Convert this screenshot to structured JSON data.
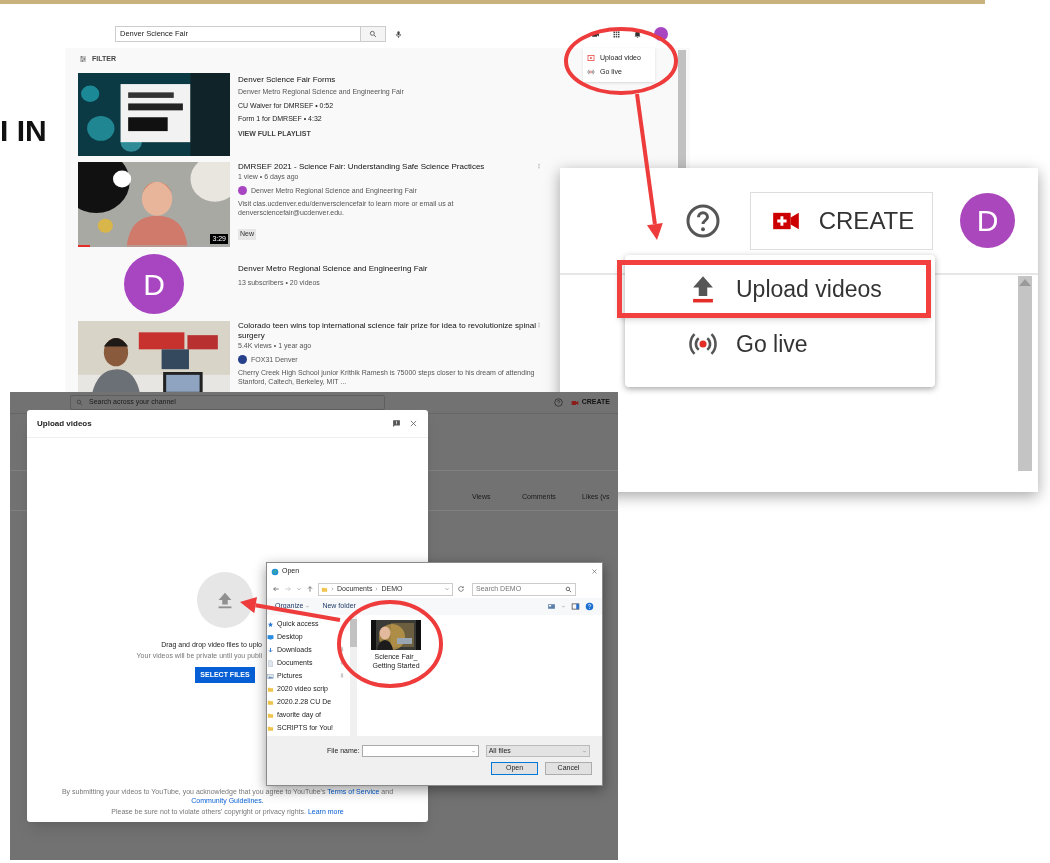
{
  "heading_fragment": "I IN",
  "results_page": {
    "search": {
      "value": "Denver Science Fair"
    },
    "create_menu": [
      {
        "label": "Upload video",
        "kind": "upload"
      },
      {
        "label": "Go live",
        "kind": "live"
      }
    ],
    "filter_label": "FILTER",
    "results": [
      {
        "kind": "playlist",
        "title": "Denver Science Fair Forms",
        "channel": "Denver Metro Regional Science and Engineering Fair",
        "items": [
          "CU Waiver for DMRSEF • 0:52",
          "Form 1 for DMRSEF • 4:32"
        ],
        "link": "VIEW FULL PLAYLIST"
      },
      {
        "kind": "video",
        "title": "DMRSEF 2021 - Science Fair: Understanding Safe Science Practices",
        "meta": "1 view • 6 days ago",
        "channel": "Denver Metro Regional Science and Engineering Fair",
        "color": "#a845c1",
        "description": "Visit clas.ucdenver.edu/denversciencefair to learn more or email us at denversciencefair@ucdenver.edu.",
        "badge": "New",
        "duration": "3:29",
        "level": 0.08
      },
      {
        "kind": "channel",
        "avatar_letter": "D",
        "title": "Denver Metro Regional Science and Engineering Fair",
        "meta": "13 subscribers • 20 videos"
      },
      {
        "kind": "video",
        "title": "Colorado teen wins top international science fair prize for idea to revolutionize spinal surgery",
        "meta": "5.4K views • 1 year ago",
        "channel": "FOX31 Denver",
        "color": "#27408b",
        "description": "Cherry Creek High School junior Krithik Ramesh is 75000 steps closer to his dream of attending Stanford, Caltech, Berkeley, MIT ..."
      }
    ]
  },
  "create_menu_zoom": {
    "create_label": "CREATE",
    "avatar_letter": "D",
    "menu": [
      {
        "label": "Upload videos",
        "kind": "upload",
        "highlighted": true
      },
      {
        "label": "Go live",
        "kind": "live",
        "highlighted": false
      }
    ]
  },
  "studio_page": {
    "search_placeholder": "Search across your channel",
    "create_label": "CREATE",
    "columns": [
      "Views",
      "Comments",
      "Likes (vs"
    ],
    "dialog": {
      "title": "Upload videos",
      "prompt": "Drag and drop video files to uplo",
      "note": "Your videos will be private until you publi",
      "button": "SELECT FILES",
      "terms": [
        {
          "text": "By submitting your videos to YouTube, you acknowledge that you agree to YouTube's",
          "link": false
        },
        {
          "text": "Terms of Service",
          "link": true
        },
        {
          "text": "and",
          "link": false
        },
        {
          "text": "Community Guidelines.",
          "link": true
        }
      ],
      "notice": [
        {
          "text": "Please be sure not to violate others' copyright or privacy rights.",
          "link": false
        },
        {
          "text": "Learn more",
          "link": true
        }
      ]
    }
  },
  "open_dialog": {
    "title": "Open",
    "path": [
      "Documents",
      "DEMO"
    ],
    "search_placeholder": "Search DEMO",
    "organize": "Organize",
    "new_folder": "New folder",
    "sidebar": [
      {
        "label": "Quick access",
        "kind": "quick"
      },
      {
        "label": "Desktop",
        "kind": "desktop",
        "pinned": false
      },
      {
        "label": "Downloads",
        "kind": "download",
        "pinned": true
      },
      {
        "label": "Documents",
        "kind": "document",
        "pinned": true
      },
      {
        "label": "Pictures",
        "kind": "pictures",
        "pinned": true
      },
      {
        "label": "2020 video scrip",
        "kind": "folder"
      },
      {
        "label": "2020.2.28 CU De",
        "kind": "folder"
      },
      {
        "label": "favorite day of",
        "kind": "folder"
      },
      {
        "label": "SCRIPTS for You!",
        "kind": "folder"
      }
    ],
    "files": [
      {
        "name": "Science Fair_ Getting Started"
      }
    ],
    "file_name_label": "File name:",
    "file_type": "All files",
    "buttons": [
      {
        "label": "Open",
        "default": true
      },
      {
        "label": "Cancel",
        "default": false
      }
    ]
  }
}
